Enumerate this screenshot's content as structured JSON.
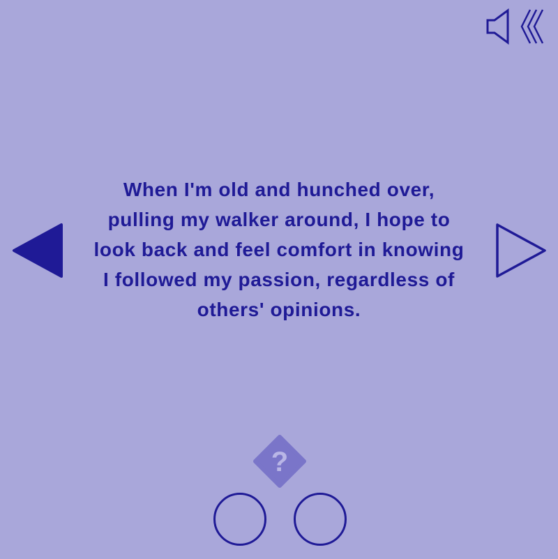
{
  "quote": {
    "text": "When I'm old and hunched over, pulling my walker around, I hope to look back and feel comfort in knowing I followed my passion, regardless of others' opinions."
  },
  "controls": {
    "sound_icon": "speaker-icon",
    "back_icon": "triple-chevron-left-icon",
    "prev_icon": "triangle-left-filled-icon",
    "next_icon": "triangle-right-outline-icon",
    "help_icon": "question-diamond-icon",
    "help_label": "?"
  },
  "answer_options": [
    {
      "name": "option-1"
    },
    {
      "name": "option-2"
    }
  ],
  "colors": {
    "background": "#a9a7da",
    "accent": "#1f1a96",
    "help_badge": "#7a75c9",
    "help_text": "#b9b6e6"
  }
}
